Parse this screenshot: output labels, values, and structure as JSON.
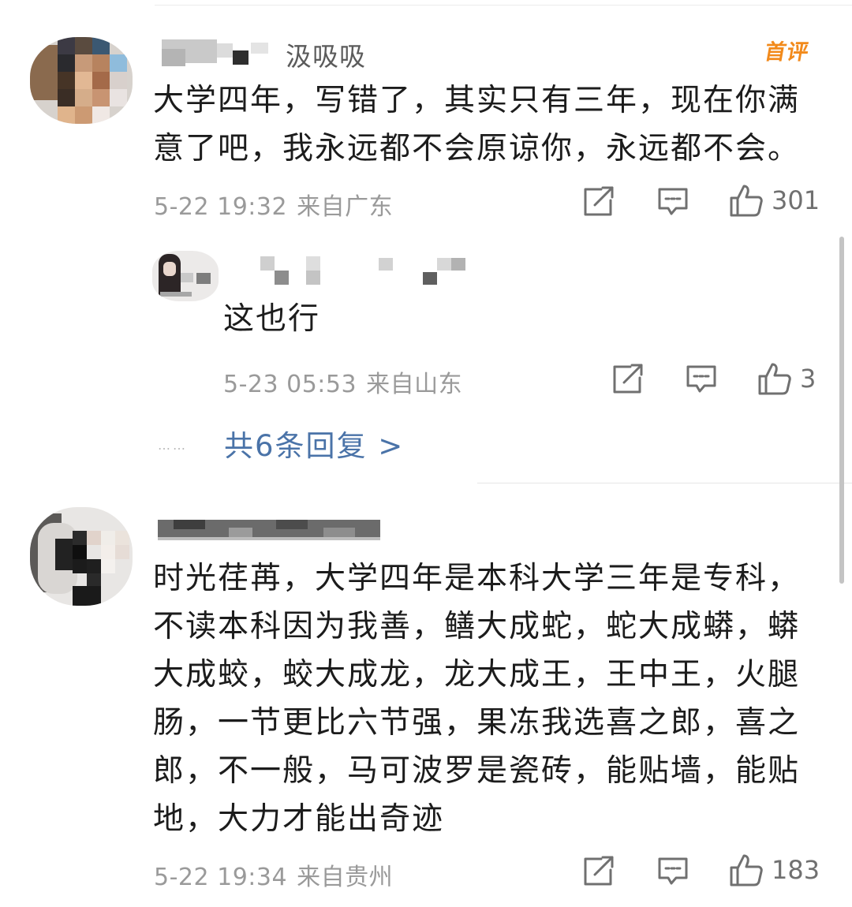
{
  "first_badge": "首评",
  "comments": [
    {
      "username_partial": "汲吸吸",
      "content": "大学四年，写错了，其实只有三年，现在你满意了吧，我永远都不会原谅你，永远都不会。",
      "time": "5-22 19:32",
      "location": "来自广东",
      "likes": "301"
    },
    {
      "username_partial": "",
      "content": "时光荏苒，大学四年是本科大学三年是专科，不读本科因为我善，鳝大成蛇，蛇大成蟒，蟒大成蛟，蛟大成龙，龙大成王，王中王，火腿肠，一节更比六节强，果冻我选喜之郎，喜之郎，不一般，马可波罗是瓷砖，能贴墙，能贴地，大力才能出奇迹",
      "time": "5-22 19:34",
      "location": "来自贵州",
      "likes": "183"
    }
  ],
  "reply": {
    "content": "这也行",
    "time": "5-23 05:53",
    "location": "来自山东",
    "likes": "3"
  },
  "more_replies_label": "共6条回复 >",
  "more_dots": "……",
  "icons": {
    "repost": "repost-icon",
    "comment": "comment-icon",
    "like": "thumbs-up-icon"
  },
  "colors": {
    "link": "#4a73a8",
    "badge": "#f28a1b",
    "meta": "#9a9a9a"
  }
}
